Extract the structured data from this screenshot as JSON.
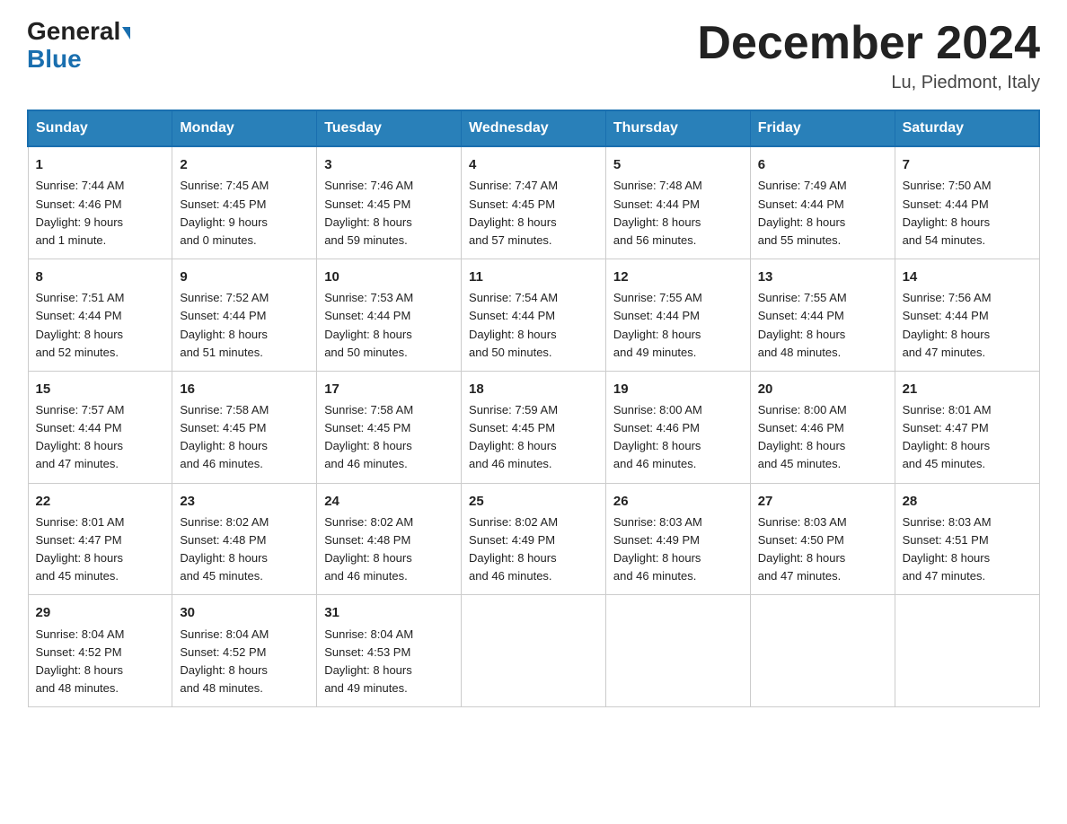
{
  "header": {
    "logo_line1": "General",
    "logo_line2": "Blue",
    "title": "December 2024",
    "subtitle": "Lu, Piedmont, Italy"
  },
  "days_of_week": [
    "Sunday",
    "Monday",
    "Tuesday",
    "Wednesday",
    "Thursday",
    "Friday",
    "Saturday"
  ],
  "weeks": [
    [
      {
        "day": "1",
        "sunrise": "7:44 AM",
        "sunset": "4:46 PM",
        "daylight": "9 hours and 1 minute."
      },
      {
        "day": "2",
        "sunrise": "7:45 AM",
        "sunset": "4:45 PM",
        "daylight": "9 hours and 0 minutes."
      },
      {
        "day": "3",
        "sunrise": "7:46 AM",
        "sunset": "4:45 PM",
        "daylight": "8 hours and 59 minutes."
      },
      {
        "day": "4",
        "sunrise": "7:47 AM",
        "sunset": "4:45 PM",
        "daylight": "8 hours and 57 minutes."
      },
      {
        "day": "5",
        "sunrise": "7:48 AM",
        "sunset": "4:44 PM",
        "daylight": "8 hours and 56 minutes."
      },
      {
        "day": "6",
        "sunrise": "7:49 AM",
        "sunset": "4:44 PM",
        "daylight": "8 hours and 55 minutes."
      },
      {
        "day": "7",
        "sunrise": "7:50 AM",
        "sunset": "4:44 PM",
        "daylight": "8 hours and 54 minutes."
      }
    ],
    [
      {
        "day": "8",
        "sunrise": "7:51 AM",
        "sunset": "4:44 PM",
        "daylight": "8 hours and 52 minutes."
      },
      {
        "day": "9",
        "sunrise": "7:52 AM",
        "sunset": "4:44 PM",
        "daylight": "8 hours and 51 minutes."
      },
      {
        "day": "10",
        "sunrise": "7:53 AM",
        "sunset": "4:44 PM",
        "daylight": "8 hours and 50 minutes."
      },
      {
        "day": "11",
        "sunrise": "7:54 AM",
        "sunset": "4:44 PM",
        "daylight": "8 hours and 50 minutes."
      },
      {
        "day": "12",
        "sunrise": "7:55 AM",
        "sunset": "4:44 PM",
        "daylight": "8 hours and 49 minutes."
      },
      {
        "day": "13",
        "sunrise": "7:55 AM",
        "sunset": "4:44 PM",
        "daylight": "8 hours and 48 minutes."
      },
      {
        "day": "14",
        "sunrise": "7:56 AM",
        "sunset": "4:44 PM",
        "daylight": "8 hours and 47 minutes."
      }
    ],
    [
      {
        "day": "15",
        "sunrise": "7:57 AM",
        "sunset": "4:44 PM",
        "daylight": "8 hours and 47 minutes."
      },
      {
        "day": "16",
        "sunrise": "7:58 AM",
        "sunset": "4:45 PM",
        "daylight": "8 hours and 46 minutes."
      },
      {
        "day": "17",
        "sunrise": "7:58 AM",
        "sunset": "4:45 PM",
        "daylight": "8 hours and 46 minutes."
      },
      {
        "day": "18",
        "sunrise": "7:59 AM",
        "sunset": "4:45 PM",
        "daylight": "8 hours and 46 minutes."
      },
      {
        "day": "19",
        "sunrise": "8:00 AM",
        "sunset": "4:46 PM",
        "daylight": "8 hours and 46 minutes."
      },
      {
        "day": "20",
        "sunrise": "8:00 AM",
        "sunset": "4:46 PM",
        "daylight": "8 hours and 45 minutes."
      },
      {
        "day": "21",
        "sunrise": "8:01 AM",
        "sunset": "4:47 PM",
        "daylight": "8 hours and 45 minutes."
      }
    ],
    [
      {
        "day": "22",
        "sunrise": "8:01 AM",
        "sunset": "4:47 PM",
        "daylight": "8 hours and 45 minutes."
      },
      {
        "day": "23",
        "sunrise": "8:02 AM",
        "sunset": "4:48 PM",
        "daylight": "8 hours and 45 minutes."
      },
      {
        "day": "24",
        "sunrise": "8:02 AM",
        "sunset": "4:48 PM",
        "daylight": "8 hours and 46 minutes."
      },
      {
        "day": "25",
        "sunrise": "8:02 AM",
        "sunset": "4:49 PM",
        "daylight": "8 hours and 46 minutes."
      },
      {
        "day": "26",
        "sunrise": "8:03 AM",
        "sunset": "4:49 PM",
        "daylight": "8 hours and 46 minutes."
      },
      {
        "day": "27",
        "sunrise": "8:03 AM",
        "sunset": "4:50 PM",
        "daylight": "8 hours and 47 minutes."
      },
      {
        "day": "28",
        "sunrise": "8:03 AM",
        "sunset": "4:51 PM",
        "daylight": "8 hours and 47 minutes."
      }
    ],
    [
      {
        "day": "29",
        "sunrise": "8:04 AM",
        "sunset": "4:52 PM",
        "daylight": "8 hours and 48 minutes."
      },
      {
        "day": "30",
        "sunrise": "8:04 AM",
        "sunset": "4:52 PM",
        "daylight": "8 hours and 48 minutes."
      },
      {
        "day": "31",
        "sunrise": "8:04 AM",
        "sunset": "4:53 PM",
        "daylight": "8 hours and 49 minutes."
      },
      null,
      null,
      null,
      null
    ]
  ],
  "labels": {
    "sunrise": "Sunrise:",
    "sunset": "Sunset:",
    "daylight": "Daylight:"
  }
}
